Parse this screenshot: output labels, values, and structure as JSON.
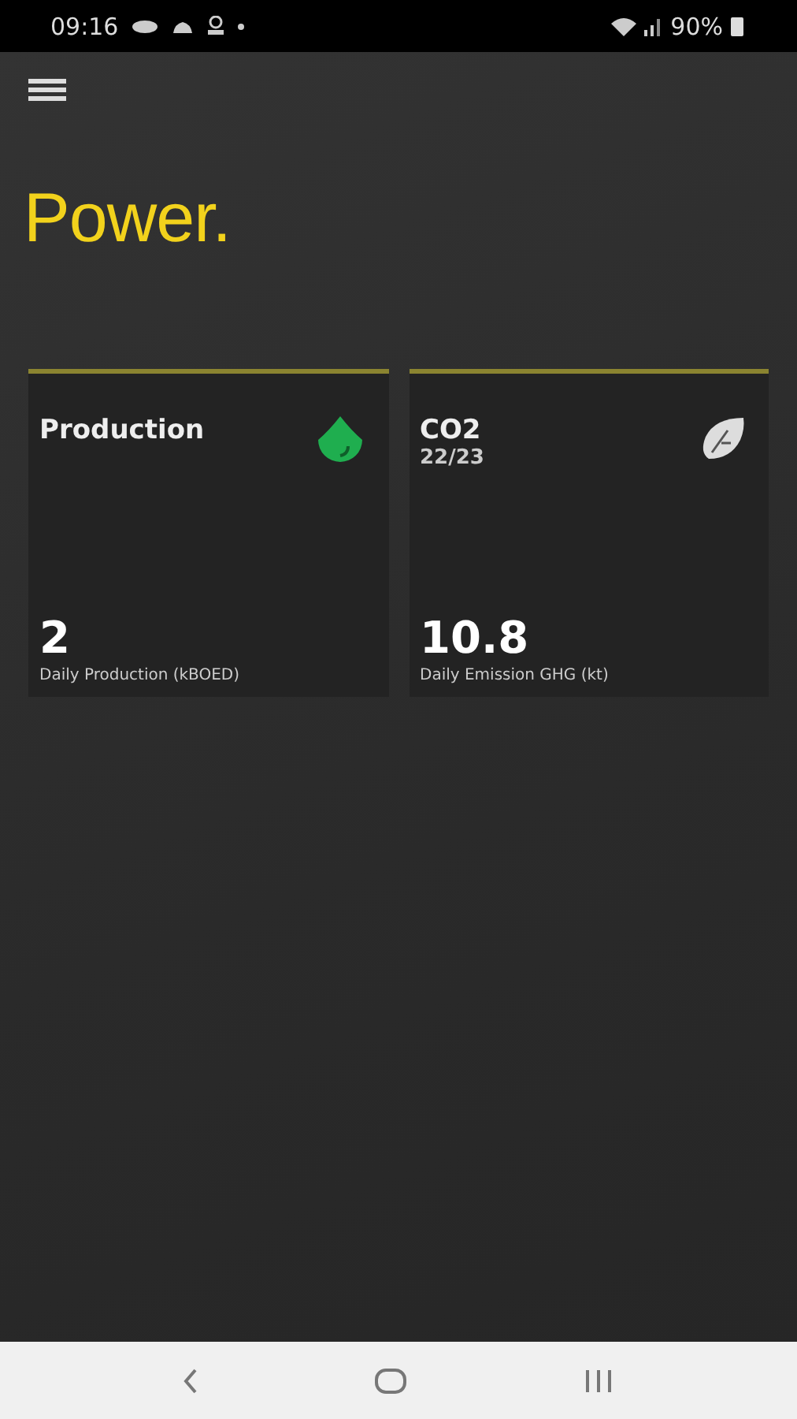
{
  "status_bar": {
    "time": "09:16",
    "battery": "90%"
  },
  "app": {
    "title": "Power."
  },
  "cards": [
    {
      "kind": "production",
      "title": "Production",
      "value": "2",
      "caption": "Daily Production (kBOED)"
    },
    {
      "kind": "emission",
      "title": "CO2",
      "subtitle": "22/23",
      "value": "10.8",
      "caption": "Daily Emission GHG (kt)"
    }
  ]
}
